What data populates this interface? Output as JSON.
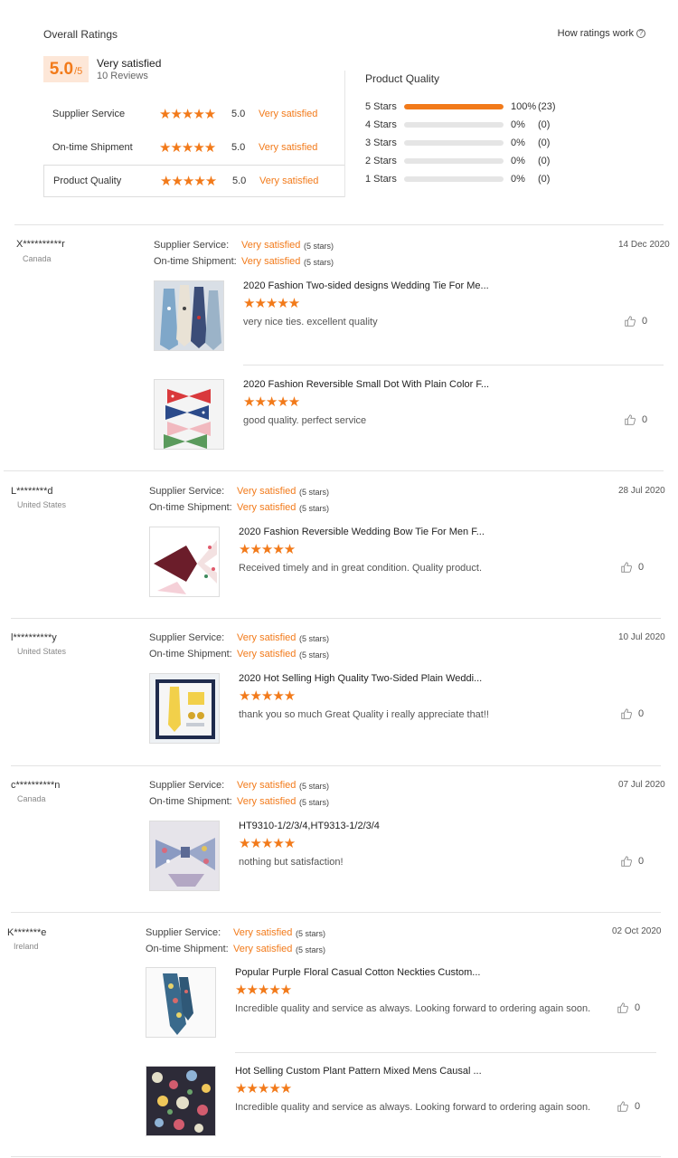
{
  "summary": {
    "title": "Overall Ratings",
    "how_label": "How ratings work",
    "score": "5.0",
    "score_of": "/5",
    "satisfaction": "Very satisfied",
    "reviews": "10 Reviews",
    "categories": [
      {
        "label": "Supplier Service",
        "stars": "★★★★★",
        "score": "5.0",
        "sat": "Very satisfied"
      },
      {
        "label": "On-time Shipment",
        "stars": "★★★★★",
        "score": "5.0",
        "sat": "Very satisfied"
      },
      {
        "label": "Product Quality",
        "stars": "★★★★★",
        "score": "5.0",
        "sat": "Very satisfied"
      }
    ],
    "pq_title": "Product Quality",
    "bars": [
      {
        "label": "5  Stars",
        "fraction": 1.0,
        "pct": "100%",
        "count": "(23)"
      },
      {
        "label": "4  Stars",
        "fraction": 0,
        "pct": "0%",
        "count": "(0)"
      },
      {
        "label": "3  Stars",
        "fraction": 0,
        "pct": "0%",
        "count": "(0)"
      },
      {
        "label": "2  Stars",
        "fraction": 0,
        "pct": "0%",
        "count": "(0)"
      },
      {
        "label": "1  Stars",
        "fraction": 0,
        "pct": "0%",
        "count": "(0)"
      }
    ]
  },
  "labels": {
    "supplier_service": "Supplier Service:",
    "ontime_shipment": "On-time Shipment:",
    "very_satisfied": "Very satisfied",
    "five_stars": "(5 stars)",
    "stars": "★★★★★"
  },
  "colors": {
    "accent": "#f27a1a",
    "score_bg": "#fde7d8"
  },
  "reviews": [
    {
      "buyer": "X**********r",
      "country": "Canada",
      "date": "14 Dec 2020",
      "items": [
        {
          "title": "2020 Fashion Two-sided designs Wedding Tie For Me...",
          "text": "very nice ties. excellent quality",
          "likes": "0"
        },
        {
          "title": "2020 Fashion Reversible Small Dot With Plain Color F...",
          "text": "good quality. perfect service",
          "likes": "0"
        }
      ]
    },
    {
      "buyer": "L********d",
      "country": "United States",
      "date": "28 Jul 2020",
      "items": [
        {
          "title": "2020 Fashion Reversible Wedding Bow Tie For Men F...",
          "text": "Received timely and in great condition. Quality product.",
          "likes": "0"
        }
      ]
    },
    {
      "buyer": "l**********y",
      "country": "United States",
      "date": "10 Jul 2020",
      "items": [
        {
          "title": "2020 Hot Selling High Quality Two-Sided Plain Weddi...",
          "text": "thank you so much Great Quality i really appreciate that!!",
          "likes": "0"
        }
      ]
    },
    {
      "buyer": "c**********n",
      "country": "Canada",
      "date": "07 Jul 2020",
      "items": [
        {
          "title": "HT9310-1/2/3/4,HT9313-1/2/3/4",
          "text": "nothing but satisfaction!",
          "likes": "0"
        }
      ]
    },
    {
      "buyer": "K*******e",
      "country": "Ireland",
      "date": "02 Oct 2020",
      "items": [
        {
          "title": "Popular Purple Floral Casual Cotton Neckties Custom...",
          "text": "Incredible quality and service as always. Looking forward to ordering again soon.",
          "likes": "0"
        },
        {
          "title": "Hot Selling Custom Plant Pattern Mixed Mens Causal ...",
          "text": "Incredible quality and service as always. Looking forward to ordering again soon.",
          "likes": "0"
        }
      ]
    }
  ]
}
